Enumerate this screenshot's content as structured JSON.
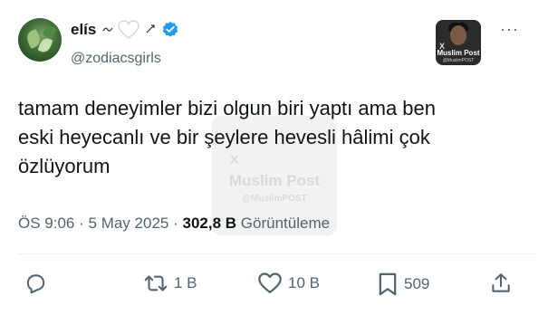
{
  "tweet": {
    "display_name": "elís",
    "handle": "@zodiacsgirls",
    "text_lines": [
      "tamam deneyimler bizi olgun biri yaptı ama ben",
      "eski heyecanlı ve bir şeylere hevesli hâlimi çok",
      "özlüyorum"
    ],
    "time": "ÖS 9:06",
    "separator": "·",
    "date": "5 May 2025",
    "views_count": "302,8 B",
    "views_label": "Görüntüleme"
  },
  "header": {
    "more_label": "···",
    "icons": [
      "small-decoration-icon",
      "heart-icon",
      "verified-badge-icon"
    ]
  },
  "brand": {
    "name": "Muslim Post",
    "handle": "@MuslimPOST",
    "x_mark": "X"
  },
  "actions": {
    "reply_icon": "reply-icon",
    "retweet_count": "1 B",
    "like_count": "10 B",
    "bookmark_count": "509",
    "share_icon": "share-icon"
  },
  "colors": {
    "text": "#0f1419",
    "secondary": "#536471",
    "verified": "#1d9bf0"
  }
}
